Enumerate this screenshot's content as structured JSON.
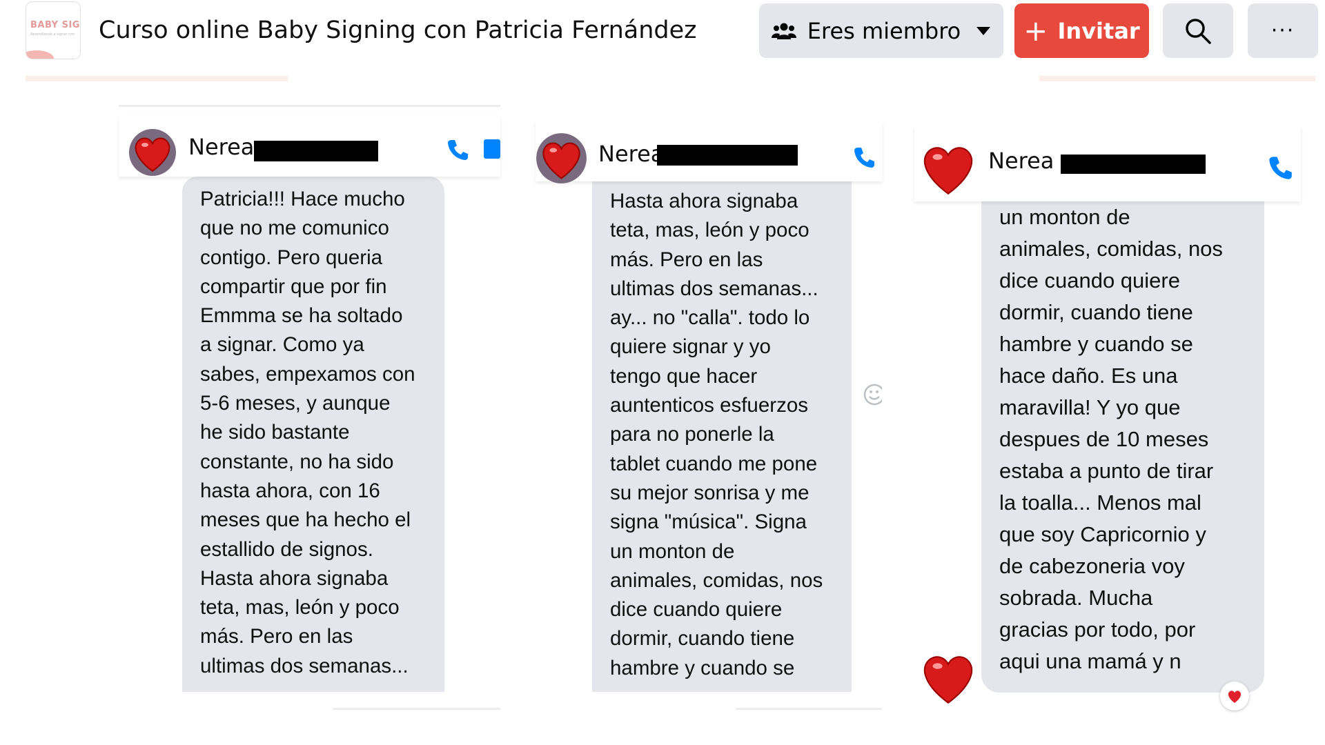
{
  "header": {
    "logo_text": "BABY SIGNI",
    "logo_subtext": "Aprendiendo a signar con",
    "title": "Curso online Baby Signing con Patricia Fernández",
    "member_button": "Eres miembro",
    "invite_button": "Invitar",
    "icons": {
      "member": "group-icon",
      "dropdown": "caret-down-icon",
      "invite": "plus-icon",
      "search": "search-icon",
      "more": "more-icon"
    },
    "more_label": "···"
  },
  "colors": {
    "accent": "#e7493c",
    "button_gray": "#e4e6eb",
    "messenger_blue": "#0084ff",
    "bubble": "#e4e6eb",
    "heart": "#d91a1a"
  },
  "chats": [
    {
      "contact_name": "Nerea",
      "message": "Patricia!!! Hace mucho\nque no me comunico\ncontigo. Pero queria\ncompartir que por fin\nEmmma se ha soltado\na signar. Como ya\nsabes, empexamos con\n5-6 meses, y aunque\nhe sido bastante\nconstante, no ha sido\nhasta ahora, con 16\nmeses que ha hecho el\nestallido de signos.\nHasta ahora signaba\nteta, mas, león y poco\nmás. Pero en las\nultimas dos semanas..."
    },
    {
      "contact_name": "Nerea",
      "message": "Hasta ahora signaba\nteta, mas, león y poco\nmás. Pero en las\nultimas dos semanas...\nay... no \"calla\". todo lo\nquiere signar y yo\ntengo que hacer\nauntenticos esfuerzos\npara no ponerle la\ntablet cuando me pone\nsu mejor sonrisa y me\nsigna \"música\". Signa\nun monton de\nanimales, comidas, nos\ndice cuando quiere\ndormir, cuando tiene\nhambre y cuando se"
    },
    {
      "contact_name": "Nerea",
      "message": "un monton de\nanimales, comidas, nos\ndice cuando quiere\ndormir, cuando tiene\nhambre y cuando se\nhace daño. Es una\nmaravilla! Y yo que\ndespues de 10 meses\nestaba a punto de tirar\nla toalla... Menos mal\nque soy Capricornio y\nde cabezoneria voy\nsobrada. Mucha\ngracias por todo, por\naqui una mamá y n"
    }
  ]
}
